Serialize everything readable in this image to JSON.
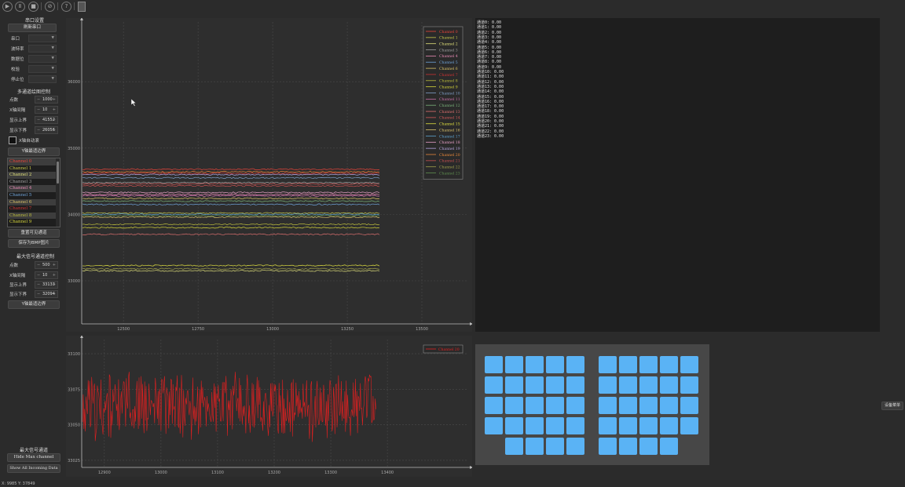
{
  "toolbar": {
    "icons": [
      "play-icon",
      "pause-icon",
      "stop-icon",
      "clear-icon",
      "help-icon",
      "document-icon"
    ]
  },
  "serial": {
    "title": "串口设置",
    "refresh_label": "刷新串口",
    "fields": [
      {
        "label": "串口",
        "value": ""
      },
      {
        "label": "波特率",
        "value": ""
      },
      {
        "label": "数据位",
        "value": ""
      },
      {
        "label": "校验",
        "value": ""
      },
      {
        "label": "停止位",
        "value": ""
      }
    ]
  },
  "multi": {
    "title": "多通道绘图控制",
    "points_label": "点数",
    "points_value": "1000",
    "xtick_label": "X轴间隔",
    "xtick_value": "10",
    "upper_label": "显示上界",
    "upper_value": "41552",
    "lower_label": "显示下界",
    "lower_value": "26056",
    "autoscroll_label": "X轴自动滚",
    "ybound_label": "Y轴最适边界",
    "channels": [
      "Channel 0",
      "Channel 1",
      "Channel 2",
      "Channel 3",
      "Channel 4",
      "Channel 5",
      "Channel 6",
      "Channel 7",
      "Channel 8",
      "Channel 9"
    ],
    "reset_label": "重置可见通道",
    "savebmp_label": "保存为BMP图片"
  },
  "maxsig": {
    "title": "最大信号通道控制",
    "points_label": "点数",
    "points_value": "500",
    "xtick_label": "X轴间隔",
    "xtick_value": "10",
    "upper_label": "显示上界",
    "upper_value": "33133",
    "lower_label": "显示下界",
    "lower_value": "32094",
    "ybound_label": "Y轴最适边界"
  },
  "maxch": {
    "title": "最大信号通道",
    "hide_label": "Hide Max channel",
    "show_all_label": "Show All Incoming Data"
  },
  "status": {
    "coords": "X: 9985  Y: 37849"
  },
  "side_button": "设备菜单",
  "text_panel": {
    "lines": [
      "通道0: 0.00",
      "通道1: 0.00",
      "通道2: 0.00",
      "通道3: 0.00",
      "通道4: 0.00",
      "通道5: 0.00",
      "通道6: 0.00",
      "通道7: 0.00",
      "通道8: 0.00",
      "通道9: 0.00",
      "通道10: 0.00",
      "通道11: 0.00",
      "通道12: 0.00",
      "通道13: 0.00",
      "通道14: 0.00",
      "通道15: 0.00",
      "通道16: 0.00",
      "通道17: 0.00",
      "通道18: 0.00",
      "通道19: 0.00",
      "通道20: 0.00",
      "通道21: 0.00",
      "通道22: 0.00",
      "通道23: 0.00"
    ]
  },
  "chart_data": [
    {
      "type": "line",
      "xlim": [
        12360,
        13650
      ],
      "ylim": [
        32350,
        36900
      ],
      "xticks": [
        12500,
        12750,
        13000,
        13250,
        13500
      ],
      "yticks": [
        33000,
        34000,
        35000,
        36000
      ],
      "grid": true,
      "legend_position": "top-right",
      "x_end": 13360,
      "series": [
        {
          "name": "Channel 0",
          "color": "#e8443a",
          "level": 34680
        },
        {
          "name": "Channel 1",
          "color": "#c9c94a",
          "level": 34020
        },
        {
          "name": "Channel 2",
          "color": "#e0e07a",
          "level": 33150
        },
        {
          "name": "Channel 3",
          "color": "#a0a0a0",
          "level": 34480
        },
        {
          "name": "Channel 4",
          "color": "#e88ab5",
          "level": 34300
        },
        {
          "name": "Channel 5",
          "color": "#6fa3d9",
          "level": 34150
        },
        {
          "name": "Channel 6",
          "color": "#d9c267",
          "level": 34240
        },
        {
          "name": "Channel 7",
          "color": "#cc3333",
          "level": 34620
        },
        {
          "name": "Channel 8",
          "color": "#bcbc3c",
          "level": 33850
        },
        {
          "name": "Channel 9",
          "color": "#d4d43a",
          "level": 33800
        },
        {
          "name": "Channel 10",
          "color": "#7f9fc8",
          "level": 34550
        },
        {
          "name": "Channel 11",
          "color": "#c86fa8",
          "level": 34280
        },
        {
          "name": "Channel 12",
          "color": "#7ab37a",
          "level": 34200
        },
        {
          "name": "Channel 13",
          "color": "#e07070",
          "level": 33700
        },
        {
          "name": "Channel 14",
          "color": "#d45a5a",
          "level": 34460
        },
        {
          "name": "Channel 15",
          "color": "#e0e040",
          "level": 33230
        },
        {
          "name": "Channel 16",
          "color": "#d9c26a",
          "level": 33960
        },
        {
          "name": "Channel 17",
          "color": "#5da2cf",
          "level": 34000
        },
        {
          "name": "Channel 18",
          "color": "#e7a0c7",
          "level": 34330
        },
        {
          "name": "Channel 19",
          "color": "#b6a5e0",
          "level": 34600
        },
        {
          "name": "Channel 20",
          "color": "#e8883a",
          "level": 34640
        },
        {
          "name": "Channel 21",
          "color": "#c85050",
          "level": 34430
        },
        {
          "name": "Channel 22",
          "color": "#a0a04a",
          "level": 33180
        },
        {
          "name": "Channel 23",
          "color": "#5f8f4f",
          "level": 33980
        }
      ]
    },
    {
      "type": "line",
      "xlim": [
        12860,
        13540
      ],
      "ylim": [
        33020,
        33110
      ],
      "xticks": [
        12900,
        13000,
        13100,
        13200,
        13300,
        13400
      ],
      "yticks": [
        33025,
        33050,
        33075,
        33100
      ],
      "grid": true,
      "legend_position": "top-right",
      "x_end": 13380,
      "series": [
        {
          "name": "Channel 20",
          "color": "#e02020",
          "mean": 33063,
          "amplitude": 22
        }
      ]
    }
  ]
}
